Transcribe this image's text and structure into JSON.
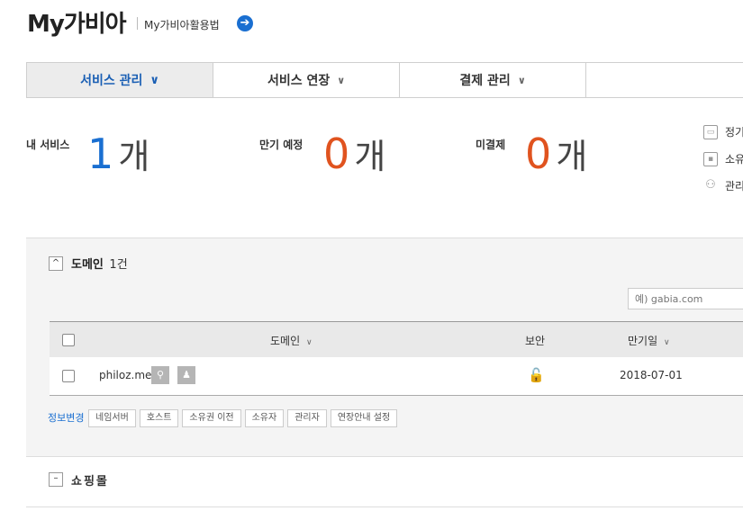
{
  "header": {
    "title": "My가비아",
    "guide_link": "My가비아활용법"
  },
  "tabs": [
    {
      "label": "서비스 관리",
      "active": true
    },
    {
      "label": "서비스 연장",
      "active": false
    },
    {
      "label": "결제 관리",
      "active": false
    }
  ],
  "summary": {
    "my_services": {
      "label": "내 서비스",
      "count": "1",
      "unit": "개"
    },
    "expiring": {
      "label": "만기 예정",
      "count": "0",
      "unit": "개"
    },
    "unpaid": {
      "label": "미결제",
      "count": "0",
      "unit": "개"
    }
  },
  "side_links": [
    "정기",
    "소유",
    "관리"
  ],
  "domain_section": {
    "title": "도메인",
    "count": "1건",
    "search_placeholder": "예) gabia.com",
    "columns": {
      "domain": "도메인",
      "security": "보안",
      "expiry": "만기일"
    },
    "rows": [
      {
        "domain": "philoz.me",
        "expiry": "2018-07-01"
      }
    ],
    "edit_label": "정보변경",
    "edit_buttons": [
      "네임서버",
      "호스트",
      "소유권 이전",
      "소유자",
      "관리자",
      "연장안내 설정"
    ]
  },
  "shopping_section": {
    "title": "쇼핑몰"
  },
  "colors": {
    "accent": "#1a6fd1",
    "warning": "#e0531f"
  }
}
